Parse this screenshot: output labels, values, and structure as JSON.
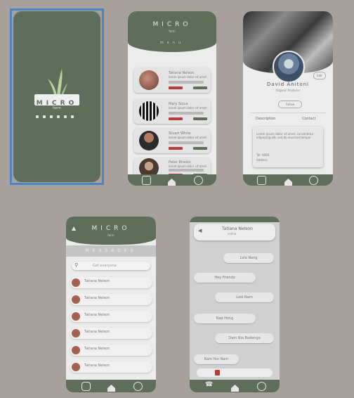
{
  "splash": {
    "logo_text": "MICRO",
    "logo_sub": "farm",
    "dots": [
      "dot",
      "dot",
      "dot",
      "dot",
      "dot",
      "dot"
    ]
  },
  "farmers_list": {
    "title": "MICRO",
    "subtitle": "farm",
    "menu_label": "menu",
    "cards": [
      {
        "name": "Tatiana Nelson",
        "desc": "lorem ipsum dolor sit amet"
      },
      {
        "name": "Mary Sicua",
        "desc": "lorem ipsum dolor sit amet"
      },
      {
        "name": "Stuart White",
        "desc": "lorem ipsum dolor sit amet"
      },
      {
        "name": "Peter Brooks",
        "desc": "lorem ipsum dolor sit amet"
      }
    ]
  },
  "profile": {
    "name": "David Anitoni",
    "role": "Organic Producer",
    "follow_label": "Follow",
    "edit_label": "Edit",
    "tab_left": "Description",
    "tab_right": "Contact",
    "description": "Lorem ipsum dolor sit amet, consectetur adipiscing elit, sed do eiusmod tempor",
    "phone_label": "Tel: 0000",
    "address_label": "Address"
  },
  "messages": {
    "title": "MICRO",
    "subtitle": "farm",
    "section_label": "MESSAGES",
    "search_placeholder": "Get everyone",
    "items": [
      {
        "name": "Tatiana Nelson"
      },
      {
        "name": "Tatiana Nelson"
      },
      {
        "name": "Tatiana Nelson"
      },
      {
        "name": "Tatiana Nelson"
      },
      {
        "name": "Tatiana Nelson"
      },
      {
        "name": "Tatiana Nelson"
      }
    ]
  },
  "chat": {
    "contact_name": "Tatiana Nelson",
    "status": "online",
    "bubbles": [
      {
        "side": "right",
        "text": "Lola Nang"
      },
      {
        "side": "left",
        "text": "Hey Friends"
      },
      {
        "side": "right",
        "text": "Lool Nam"
      },
      {
        "side": "left",
        "text": "Nap Hong"
      },
      {
        "side": "right",
        "text": "Dam Nia Badanga"
      },
      {
        "side": "left",
        "text": "Kam Yon Nam"
      }
    ]
  },
  "colors": {
    "primary_green": "#5e6e5b",
    "background": "#a7a09d",
    "card": "#e3e3e3",
    "accent_red": "#b63b3b",
    "selection": "#4a86c5"
  }
}
